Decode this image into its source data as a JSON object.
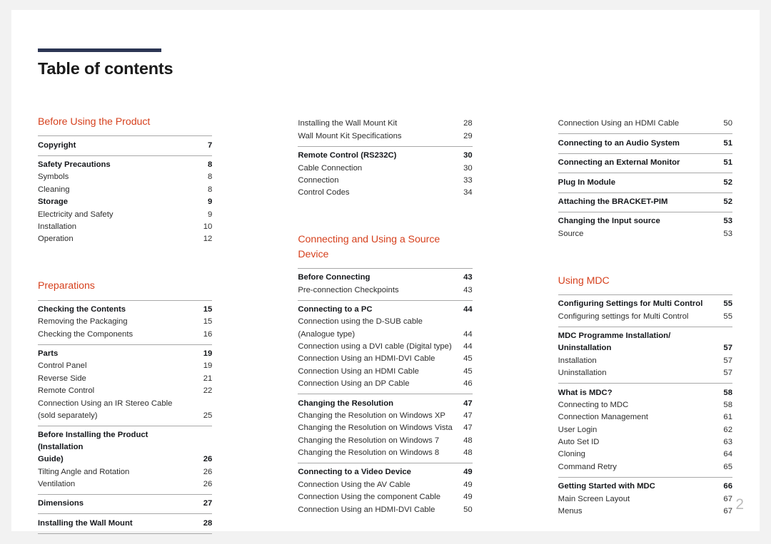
{
  "document": {
    "title": "Table of contents",
    "folio": "2",
    "accent_color": "#d6411e",
    "rule_color": "#2b3553"
  },
  "columns": [
    {
      "id": "column-1",
      "blocks": [
        {
          "type": "section",
          "title": "Before Using the Product"
        },
        {
          "type": "group",
          "entries": [
            {
              "label": "Copyright",
              "page": "7",
              "bold": true
            }
          ]
        },
        {
          "type": "group",
          "entries": [
            {
              "label": "Safety Precautions",
              "page": "8",
              "bold": true
            },
            {
              "label": "Symbols",
              "page": "8",
              "bold": false
            },
            {
              "label": "Cleaning",
              "page": "8",
              "bold": false
            },
            {
              "label": "Storage",
              "page": "9",
              "bold": true
            },
            {
              "label": "Electricity and Safety",
              "page": "9",
              "bold": false
            },
            {
              "label": "Installation",
              "page": "10",
              "bold": false
            },
            {
              "label": "Operation",
              "page": "12",
              "bold": false
            }
          ]
        },
        {
          "type": "section",
          "title": "Preparations",
          "spaced": true
        },
        {
          "type": "group",
          "entries": [
            {
              "label": "Checking the Contents",
              "page": "15",
              "bold": true
            },
            {
              "label": "Removing the Packaging",
              "page": "15",
              "bold": false
            },
            {
              "label": "Checking the Components",
              "page": "16",
              "bold": false
            }
          ]
        },
        {
          "type": "group",
          "entries": [
            {
              "label": "Parts",
              "page": "19",
              "bold": true
            },
            {
              "label": "Control Panel",
              "page": "19",
              "bold": false
            },
            {
              "label": "Reverse Side",
              "page": "21",
              "bold": false
            },
            {
              "label": "Remote Control",
              "page": "22",
              "bold": false
            },
            {
              "label": "Connection Using an IR Stereo Cable",
              "page": "",
              "bold": false,
              "nopage": true
            },
            {
              "label": "(sold separately)",
              "page": "25",
              "bold": false
            }
          ]
        },
        {
          "type": "group",
          "entries": [
            {
              "label": "Before Installing the Product (Installation",
              "page": "",
              "bold": true,
              "nopage": true
            },
            {
              "label": "Guide)",
              "page": "26",
              "bold": true
            },
            {
              "label": "Tilting Angle and Rotation",
              "page": "26",
              "bold": false
            },
            {
              "label": "Ventilation",
              "page": "26",
              "bold": false
            }
          ]
        },
        {
          "type": "group",
          "entries": [
            {
              "label": "Dimensions",
              "page": "27",
              "bold": true
            }
          ]
        },
        {
          "type": "group",
          "last": true,
          "entries": [
            {
              "label": "Installing the Wall Mount",
              "page": "28",
              "bold": true
            }
          ]
        }
      ]
    },
    {
      "id": "column-2",
      "blocks": [
        {
          "type": "group",
          "noline": true,
          "entries": [
            {
              "label": "Installing the Wall Mount Kit",
              "page": "28",
              "bold": false
            },
            {
              "label": "Wall Mount Kit Specifications",
              "page": "29",
              "bold": false
            }
          ]
        },
        {
          "type": "group",
          "entries": [
            {
              "label": "Remote Control (RS232C)",
              "page": "30",
              "bold": true
            },
            {
              "label": "Cable Connection",
              "page": "30",
              "bold": false
            },
            {
              "label": "Connection",
              "page": "33",
              "bold": false
            },
            {
              "label": "Control Codes",
              "page": "34",
              "bold": false
            }
          ]
        },
        {
          "type": "section",
          "title": "Connecting and Using a Source Device",
          "spaced": true
        },
        {
          "type": "group",
          "entries": [
            {
              "label": "Before Connecting",
              "page": "43",
              "bold": true
            },
            {
              "label": "Pre-connection Checkpoints",
              "page": "43",
              "bold": false
            }
          ]
        },
        {
          "type": "group",
          "entries": [
            {
              "label": "Connecting to a PC",
              "page": "44",
              "bold": true
            },
            {
              "label": "Connection using the D-SUB cable",
              "page": "",
              "bold": false,
              "nopage": true
            },
            {
              "label": "(Analogue type)",
              "page": "44",
              "bold": false
            },
            {
              "label": "Connection using a DVI cable (Digital type)",
              "page": "44",
              "bold": false
            },
            {
              "label": "Connection Using an HDMI-DVI Cable",
              "page": "45",
              "bold": false
            },
            {
              "label": "Connection Using an HDMI Cable",
              "page": "45",
              "bold": false
            },
            {
              "label": "Connection Using an DP Cable",
              "page": "46",
              "bold": false
            }
          ]
        },
        {
          "type": "group",
          "entries": [
            {
              "label": "Changing the Resolution",
              "page": "47",
              "bold": true
            },
            {
              "label": "Changing the Resolution on Windows XP",
              "page": "47",
              "bold": false
            },
            {
              "label": "Changing the Resolution on Windows Vista",
              "page": "47",
              "bold": false
            },
            {
              "label": "Changing the Resolution on Windows 7",
              "page": "48",
              "bold": false
            },
            {
              "label": "Changing the Resolution on Windows 8",
              "page": "48",
              "bold": false
            }
          ]
        },
        {
          "type": "group",
          "entries": [
            {
              "label": "Connecting to a Video Device",
              "page": "49",
              "bold": true
            },
            {
              "label": "Connection Using the AV Cable",
              "page": "49",
              "bold": false
            },
            {
              "label": "Connection Using the component Cable",
              "page": "49",
              "bold": false
            },
            {
              "label": "Connection Using an HDMI-DVI Cable",
              "page": "50",
              "bold": false
            }
          ]
        }
      ]
    },
    {
      "id": "column-3",
      "blocks": [
        {
          "type": "group",
          "noline": true,
          "entries": [
            {
              "label": "Connection Using an HDMI Cable",
              "page": "50",
              "bold": false
            }
          ]
        },
        {
          "type": "group",
          "entries": [
            {
              "label": "Connecting to an Audio System",
              "page": "51",
              "bold": true
            }
          ]
        },
        {
          "type": "group",
          "entries": [
            {
              "label": "Connecting an External Monitor",
              "page": "51",
              "bold": true
            }
          ]
        },
        {
          "type": "group",
          "entries": [
            {
              "label": "Plug In Module",
              "page": "52",
              "bold": true
            }
          ]
        },
        {
          "type": "group",
          "entries": [
            {
              "label": "Attaching the BRACKET-PIM",
              "page": "52",
              "bold": true
            }
          ]
        },
        {
          "type": "group",
          "entries": [
            {
              "label": "Changing the Input source",
              "page": "53",
              "bold": true
            },
            {
              "label": "Source",
              "page": "53",
              "bold": false
            }
          ]
        },
        {
          "type": "section",
          "title": "Using MDC",
          "spaced": true
        },
        {
          "type": "group",
          "entries": [
            {
              "label": "Configuring Settings for Multi Control",
              "page": "55",
              "bold": true
            },
            {
              "label": "Configuring settings for Multi Control",
              "page": "55",
              "bold": false
            }
          ]
        },
        {
          "type": "group",
          "entries": [
            {
              "label": "MDC Programme Installation/",
              "page": "",
              "bold": true,
              "nopage": true
            },
            {
              "label": "Uninstallation",
              "page": "57",
              "bold": true
            },
            {
              "label": "Installation",
              "page": "57",
              "bold": false
            },
            {
              "label": "Uninstallation",
              "page": "57",
              "bold": false
            }
          ]
        },
        {
          "type": "group",
          "entries": [
            {
              "label": "What is MDC?",
              "page": "58",
              "bold": true
            },
            {
              "label": "Connecting to MDC",
              "page": "58",
              "bold": false
            },
            {
              "label": "Connection Management",
              "page": "61",
              "bold": false
            },
            {
              "label": "User Login",
              "page": "62",
              "bold": false
            },
            {
              "label": "Auto Set ID",
              "page": "63",
              "bold": false
            },
            {
              "label": "Cloning",
              "page": "64",
              "bold": false
            },
            {
              "label": "Command Retry",
              "page": "65",
              "bold": false
            }
          ]
        },
        {
          "type": "group",
          "entries": [
            {
              "label": "Getting Started with MDC",
              "page": "66",
              "bold": true
            },
            {
              "label": "Main Screen Layout",
              "page": "67",
              "bold": false
            },
            {
              "label": "Menus",
              "page": "67",
              "bold": false
            }
          ]
        }
      ]
    }
  ]
}
